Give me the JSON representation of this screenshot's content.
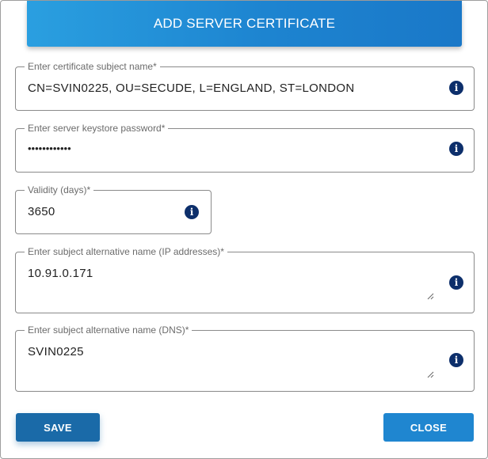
{
  "dialog": {
    "title": "ADD SERVER CERTIFICATE",
    "fields": {
      "subject": {
        "label": "Enter certificate subject name*",
        "value": "CN=SVIN0225, OU=SECUDE, L=ENGLAND, ST=LONDON"
      },
      "password": {
        "label": "Enter server keystore password*",
        "value": "••••••••••••"
      },
      "validity": {
        "label": "Validity (days)*",
        "value": "3650"
      },
      "san_ip": {
        "label": "Enter subject alternative name (IP addresses)*",
        "value": "10.91.0.171"
      },
      "san_dns": {
        "label": "Enter subject alternative name (DNS)*",
        "value": "SVIN0225"
      }
    },
    "buttons": {
      "save": "SAVE",
      "close": "CLOSE"
    },
    "info_glyph": "i",
    "colors": {
      "header": "#1d84d0",
      "info_icon": "#0d2f6b",
      "save": "#1a6aa8",
      "close": "#1f86d0"
    }
  }
}
